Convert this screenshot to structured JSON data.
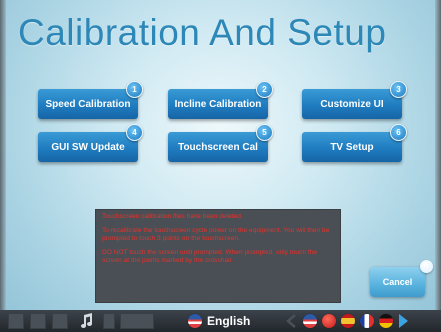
{
  "screen": {
    "title": "Calibration And Setup"
  },
  "buttons": [
    {
      "label": "Speed Calibration",
      "badge": "1"
    },
    {
      "label": "Incline Calibration",
      "badge": "2"
    },
    {
      "label": "Customize UI",
      "badge": "3"
    },
    {
      "label": "GUI SW Update",
      "badge": "4"
    },
    {
      "label": "Touchscreen Cal",
      "badge": "5"
    },
    {
      "label": "TV Setup",
      "badge": "6"
    }
  ],
  "message": {
    "line1": "Touchscreen calibration files have been deleted.",
    "line2": "To recalibrate the touchscreen cycle power on the equipment.  You will then be prompted to touch 3 points on the touchscreen.",
    "line3": "DO NOT touch the screen until prompted.  When prompted, only touch the screen at the points marked by the crosshair."
  },
  "cancel": {
    "label": "Cancel"
  },
  "taskbar": {
    "language": "English",
    "icons": [
      "window-icon",
      "window-icon",
      "window-icon",
      "music-icon",
      "window-icon",
      "window-icon",
      "us-flag-icon",
      "arrow-left-icon",
      "us-flag-icon",
      "red-flag-icon",
      "spain-flag-icon",
      "france-flag-icon",
      "germany-flag-icon",
      "arrow-right-icon"
    ]
  },
  "colors": {
    "title": "#2d87b7",
    "button": "#1f7cc0",
    "message_text": "#e5322b",
    "message_bg": "#4a4f55"
  }
}
